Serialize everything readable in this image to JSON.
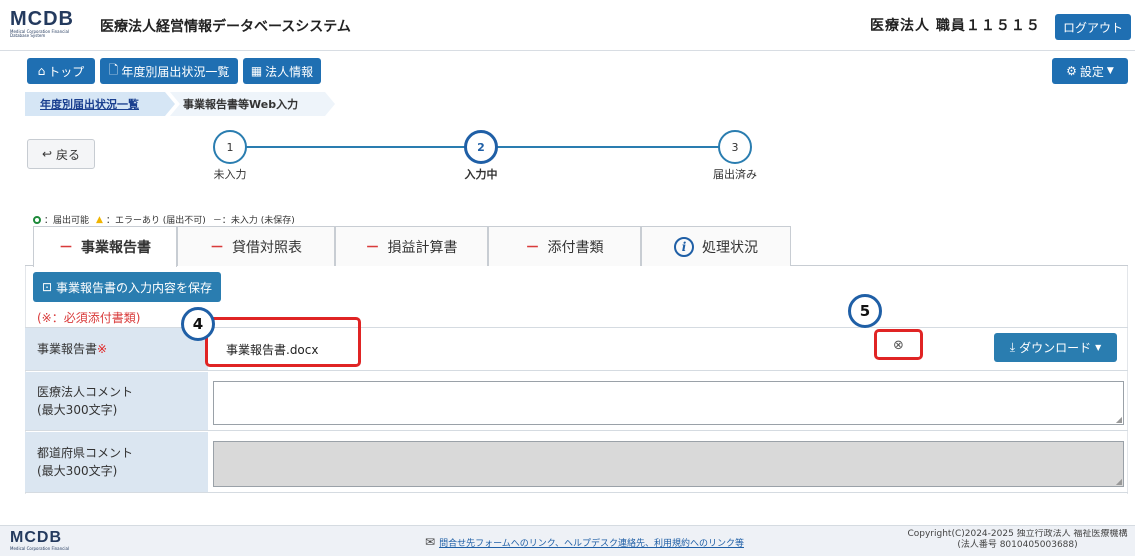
{
  "header": {
    "logo": "MCDB",
    "logo_sub": "Medical Corporation Financial Database System",
    "title": "医療法人経営情報データベースシステム",
    "user": "医療法人 職員１１５１５",
    "logout": "ログアウト"
  },
  "nav": {
    "top": "トップ",
    "yearly": "年度別届出状況一覧",
    "corp": "法人情報",
    "settings": "設定"
  },
  "breadcrumb": {
    "item1": "年度別届出状況一覧",
    "item2": "事業報告書等Web入力"
  },
  "back": "戻る",
  "steps": [
    {
      "num": "1",
      "label": "未入力"
    },
    {
      "num": "2",
      "label": "入力中"
    },
    {
      "num": "3",
      "label": "届出済み"
    }
  ],
  "legend": {
    "ok": "：届出可能",
    "err": "：エラーあり (届出不可)",
    "none": "－：未入力 (未保存)"
  },
  "tabs": [
    {
      "dash": "－",
      "label": "事業報告書"
    },
    {
      "dash": "－",
      "label": "貸借対照表"
    },
    {
      "dash": "－",
      "label": "損益計算書"
    },
    {
      "dash": "－",
      "label": "添付書類"
    },
    {
      "dash": "i",
      "label": "処理状況"
    }
  ],
  "save_btn": "事業報告書の入力内容を保存",
  "required_note": "(※：必須添付書類)",
  "form": {
    "report_label": "事業報告書",
    "required_mark": "※",
    "file_name": "事業報告書.docx",
    "download": "ダウンロード",
    "corp_comment_label": "医療法人コメント",
    "corp_comment_hint": "(最大300文字)",
    "pref_comment_label": "都道府県コメント",
    "pref_comment_hint": "(最大300文字)"
  },
  "annotations": {
    "badge4": "4",
    "badge5": "5"
  },
  "footer": {
    "logo": "MCDB",
    "logo_sub": "Medical Corporation Financial",
    "link": "問合せ先フォームへのリンク、ヘルプデスク連絡先、利用規約へのリンク等",
    "copyright": "Copyright(C)2024-2025 独立行政法人 福祉医療機構",
    "corp_no": "(法人番号 8010405003688)"
  },
  "colors": {
    "primary": "#1f6fb2",
    "label_bg": "#dbe6f1",
    "annotation_red": "#e02424"
  }
}
